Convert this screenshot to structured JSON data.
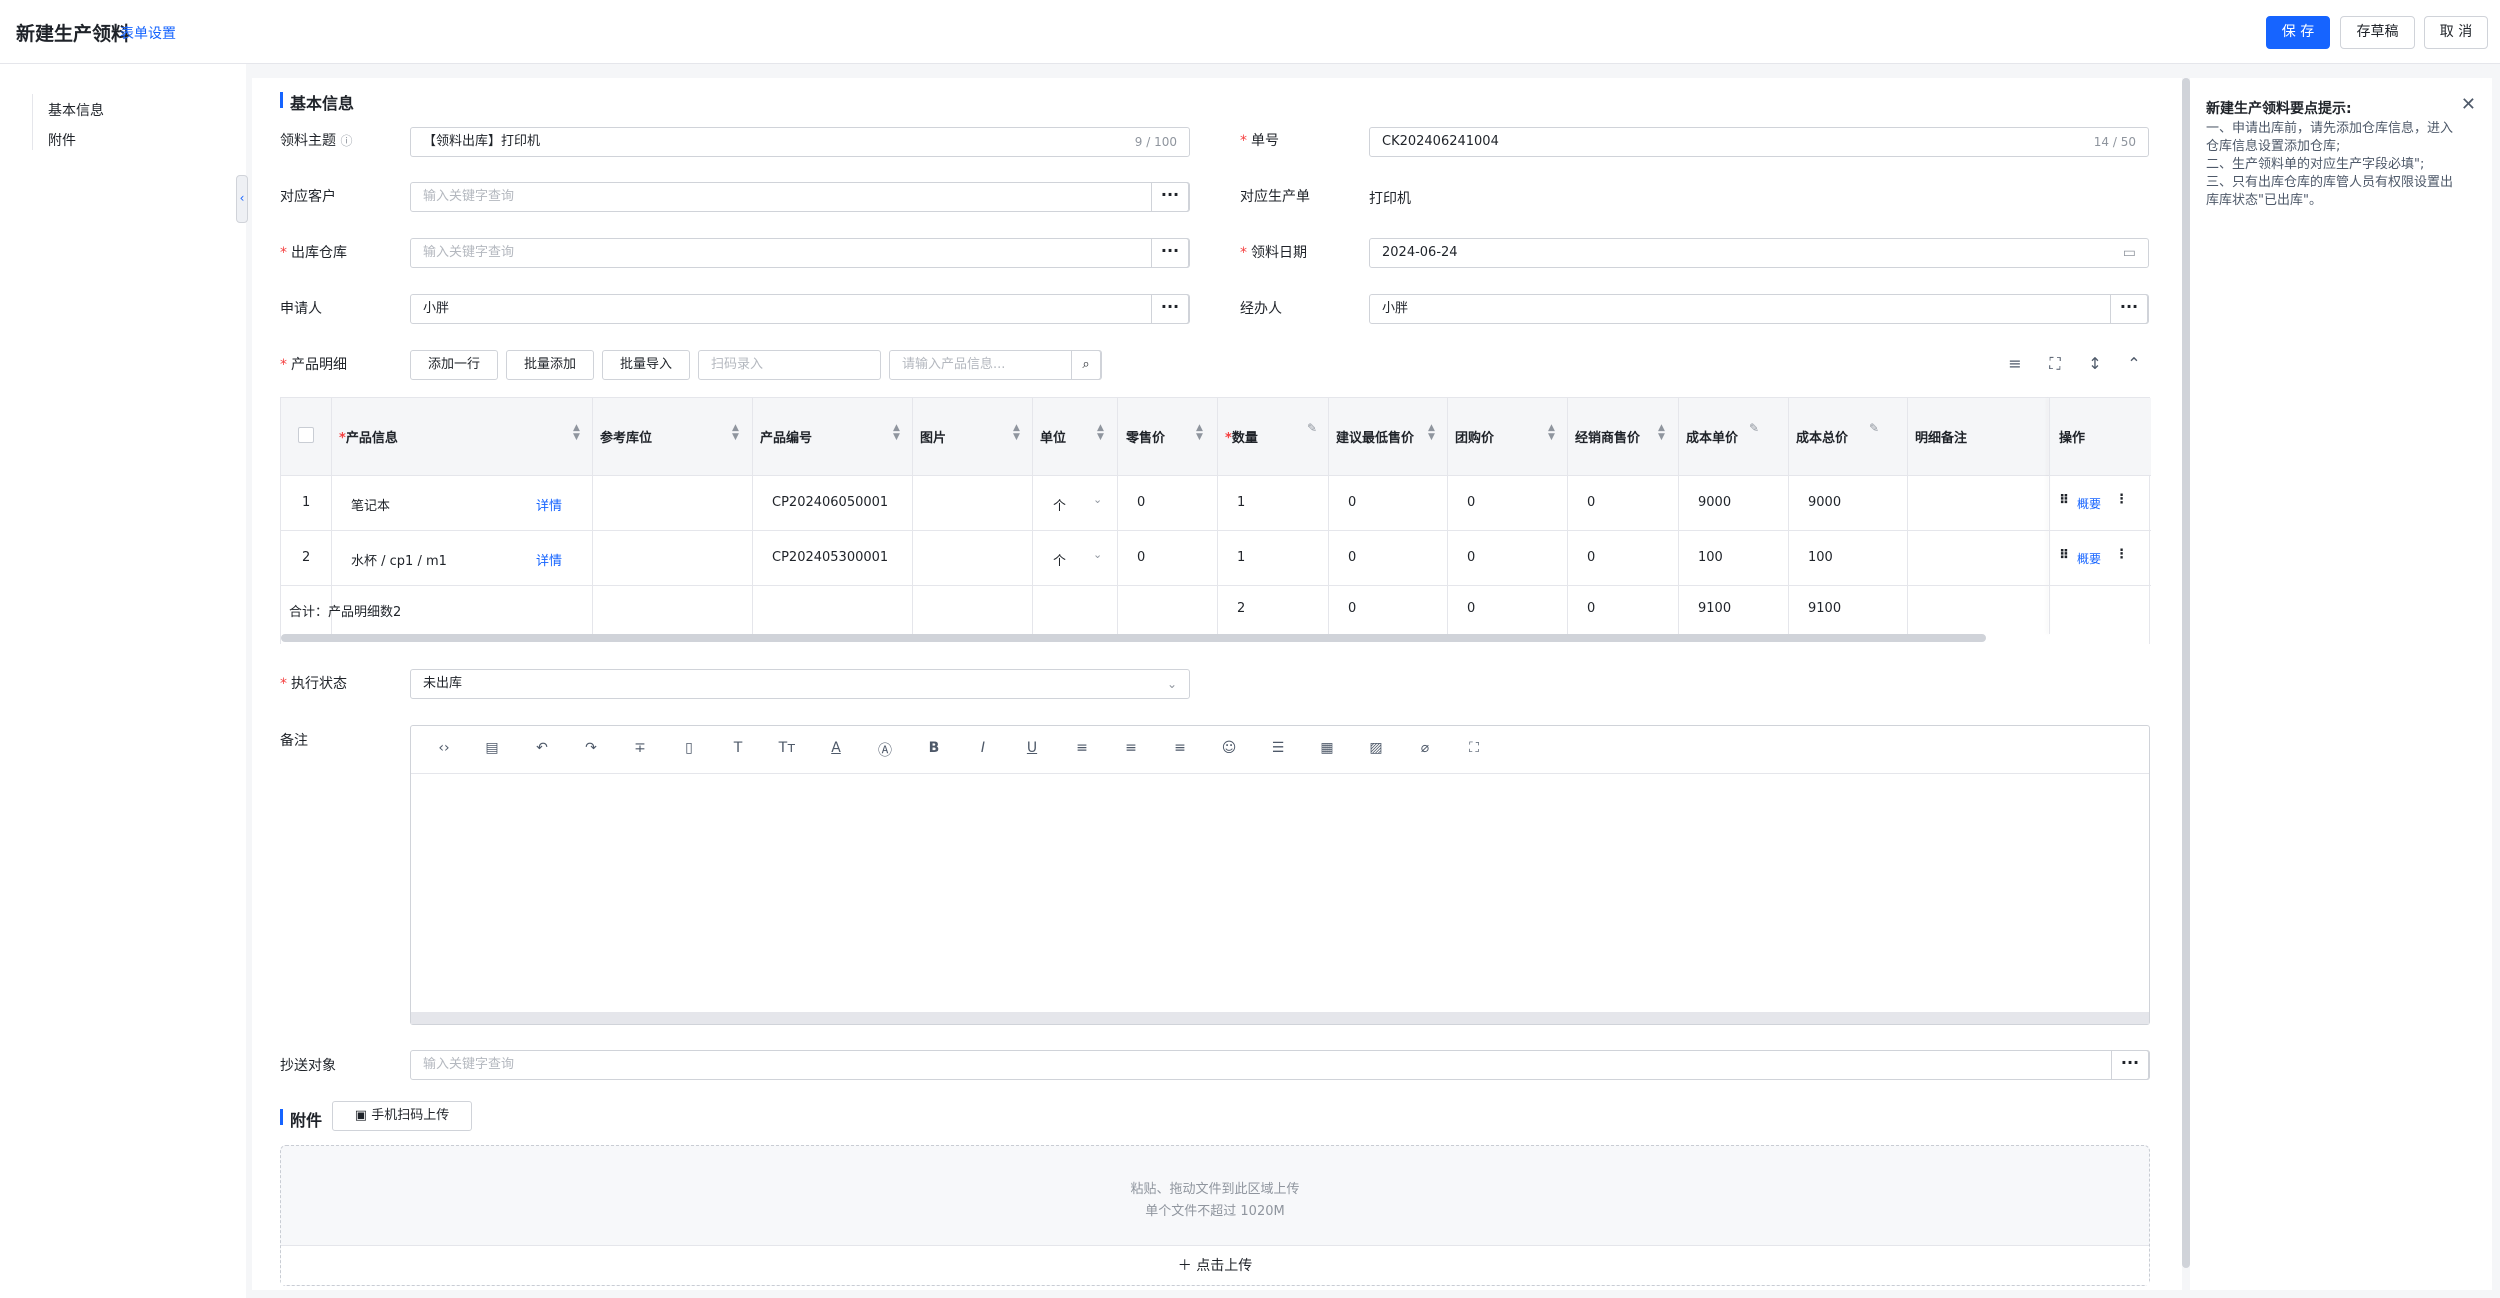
{
  "header": {
    "title": "新建生产领料",
    "form_settings": "表单设置",
    "save": "保 存",
    "draft": "存草稿",
    "cancel": "取 消"
  },
  "leftnav": {
    "items": [
      "基本信息",
      "附件"
    ]
  },
  "basic": {
    "section_title": "基本信息",
    "subject_label": "领料主题",
    "subject_value": "【领料出库】打印机",
    "subject_count": "9 / 100",
    "no_label": "单号",
    "no_value": "CK202406241004",
    "no_count": "14 / 50",
    "customer_label": "对应客户",
    "customer_placeholder": "输入关键字查询",
    "production_label": "对应生产单",
    "production_value": "打印机",
    "warehouse_label": "出库仓库",
    "warehouse_placeholder": "输入关键字查询",
    "date_label": "领料日期",
    "date_value": "2024-06-24",
    "applicant_label": "申请人",
    "applicant_value": "小胖",
    "handler_label": "经办人",
    "handler_value": "小胖"
  },
  "products": {
    "label": "产品明细",
    "add_row": "添加一行",
    "batch_add": "批量添加",
    "batch_import": "批量导入",
    "scan_placeholder": "扫码录入",
    "search_placeholder": "请输入产品信息...",
    "columns": [
      "产品信息",
      "参考库位",
      "产品编号",
      "图片",
      "单位",
      "零售价",
      "数量",
      "建议最低售价",
      "团购价",
      "经销商售价",
      "成本单价",
      "成本总价",
      "明细备注",
      "操作"
    ],
    "rows": [
      {
        "idx": "1",
        "name": "笔记本",
        "detail": "详情",
        "code": "CP202406050001",
        "unit": "个",
        "retail": "0",
        "qty": "1",
        "minprice": "0",
        "group": "0",
        "dealer": "0",
        "cost": "9000",
        "total": "9000",
        "op": "概要"
      },
      {
        "idx": "2",
        "name": "水杯 / cp1 / m1",
        "detail": "详情",
        "code": "CP202405300001",
        "unit": "个",
        "retail": "0",
        "qty": "1",
        "minprice": "0",
        "group": "0",
        "dealer": "0",
        "cost": "100",
        "total": "100",
        "op": "概要"
      }
    ],
    "summary": {
      "label": "合计：产品明细数2",
      "qty": "2",
      "minprice": "0",
      "group": "0",
      "dealer": "0",
      "cost": "9100",
      "total": "9100"
    }
  },
  "status": {
    "label": "执行状态",
    "value": "未出库"
  },
  "remark": {
    "label": "备注"
  },
  "cc": {
    "label": "抄送对象",
    "placeholder": "输入关键字查询"
  },
  "attachment": {
    "section_title": "附件",
    "mobile_upload": "手机扫码上传",
    "hint1": "粘贴、拖动文件到此区域上传",
    "hint2": "单个文件不超过 1020M",
    "click_upload": "点击上传"
  },
  "tips": {
    "title": "新建生产领料要点提示:",
    "lines": [
      "一、申请出库前，请先添加仓库信息，进入",
      "仓库信息设置添加仓库;",
      "二、生产领料单的对应生产字段必填\";",
      "三、只有出库仓库的库管人员有权限设置出",
      "库库状态\"已出库\"。"
    ]
  },
  "colors": {
    "accent": "#1664ff",
    "required": "#f53f3f"
  }
}
